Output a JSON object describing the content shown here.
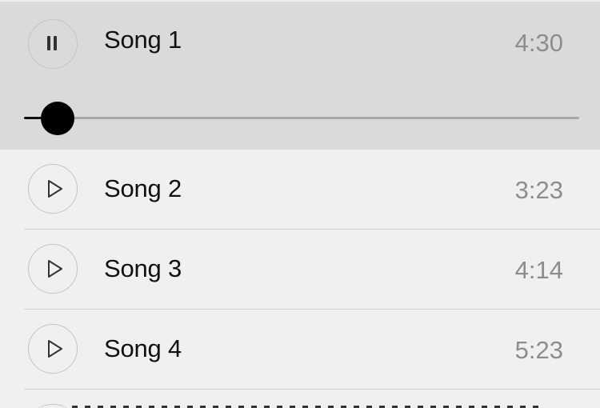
{
  "now_playing": {
    "title": "Song 1",
    "duration": "4:30",
    "state": "playing",
    "button_icon": "pause-icon",
    "progress_fraction": 0.06
  },
  "songs": [
    {
      "title": "Song 2",
      "duration": "3:23",
      "button_icon": "play-icon"
    },
    {
      "title": "Song 3",
      "duration": "4:14",
      "button_icon": "play-icon"
    },
    {
      "title": "Song 4",
      "duration": "5:23",
      "button_icon": "play-icon"
    }
  ],
  "colors": {
    "now_playing_background": "#dadada",
    "list_background": "#f0f0f0",
    "title_text": "#111111",
    "duration_text": "#8d8d8d",
    "divider": "#cfd3de",
    "slider_thumb": "#000000",
    "slider_track": "#a7a7a7"
  }
}
